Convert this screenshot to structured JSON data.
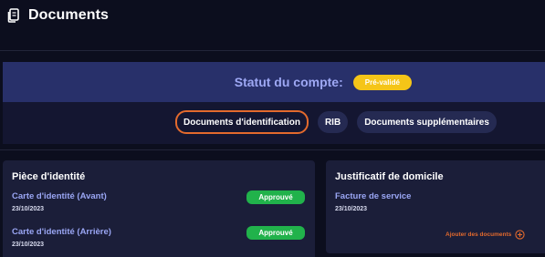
{
  "header": {
    "title": "Documents",
    "icon": "document-icon"
  },
  "status": {
    "label": "Statut du compte:",
    "badge": "Pré-validé",
    "badge_color": "#f5c518"
  },
  "tabs": [
    {
      "label": "Documents d'identification",
      "active": true
    },
    {
      "label": "RIB",
      "active": false
    },
    {
      "label": "Documents supplémentaires",
      "active": false
    }
  ],
  "cards": {
    "identity": {
      "title": "Pièce d'identité",
      "items": [
        {
          "name": "Carte d'identité (Avant)",
          "date": "23/10/2023",
          "status": "Approuvé"
        },
        {
          "name": "Carte d'identité (Arrière)",
          "date": "23/10/2023",
          "status": "Approuvé"
        }
      ]
    },
    "address": {
      "title": "Justificatif de domicile",
      "items": [
        {
          "name": "Facture de service",
          "date": "23/10/2023"
        }
      ],
      "add_label": "Ajouter des documents",
      "add_icon": "plus-circle-icon"
    }
  },
  "colors": {
    "accent": "#e36a2d",
    "approved": "#21b24b",
    "link": "#9aa6f4"
  }
}
